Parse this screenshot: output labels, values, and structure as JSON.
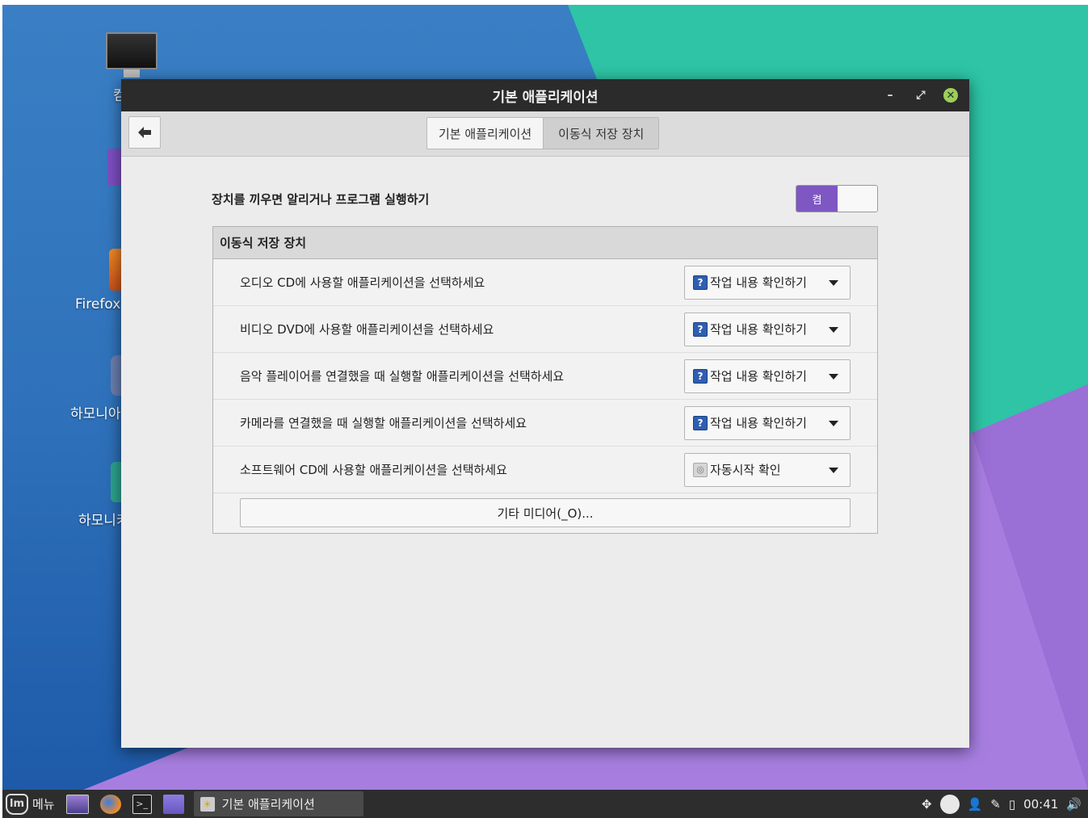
{
  "desktop": {
    "icons": [
      {
        "name": "computer",
        "label": "컴"
      },
      {
        "name": "firefox",
        "label": "Firefox"
      },
      {
        "name": "harmony1",
        "label": "하모니아"
      },
      {
        "name": "harmony2",
        "label": "하모니키"
      }
    ]
  },
  "window": {
    "title": "기본 애플리케이션",
    "controls": {
      "minimize": "–",
      "restore": "⤢",
      "close": "✕"
    },
    "back_icon": "back-arrow-icon",
    "tabs": [
      {
        "label": "기본 애플리케이션",
        "active": false
      },
      {
        "label": "이동식 저장 장치",
        "active": true
      }
    ]
  },
  "autorun": {
    "label": "장치를 끼우면 알리거나 프로그램 실행하기",
    "switch_text": "켬",
    "state": "on"
  },
  "removable_media": {
    "header": "이동식 저장 장치",
    "rows": [
      {
        "label": "오디오 CD에 사용할 애플리케이션을 선택하세요",
        "value": "작업 내용 확인하기",
        "icon": "question-icon"
      },
      {
        "label": "비디오 DVD에 사용할 애플리케이션을 선택하세요",
        "value": "작업 내용 확인하기",
        "icon": "question-icon"
      },
      {
        "label": "음악 플레이어를 연결했을 때 실행할 애플리케이션을 선택하세요",
        "value": "작업 내용 확인하기",
        "icon": "question-icon"
      },
      {
        "label": "카메라를 연결했을 때 실행할 애플리케이션을 선택하세요",
        "value": "작업 내용 확인하기",
        "icon": "question-icon"
      },
      {
        "label": "소프트웨어 CD에 사용할 애플리케이션을 선택하세요",
        "value": "자동시작 확인",
        "icon": "autorun-icon"
      }
    ],
    "other_media_button": "기타 미디어(_O)..."
  },
  "taskbar": {
    "menu_label": "메뉴",
    "task_label": "기본 애플리케이션",
    "clock": "00:41"
  },
  "colors": {
    "accent": "#7e57c2",
    "titlebar": "#2b2b2b",
    "close_button": "#9ccf5a"
  }
}
